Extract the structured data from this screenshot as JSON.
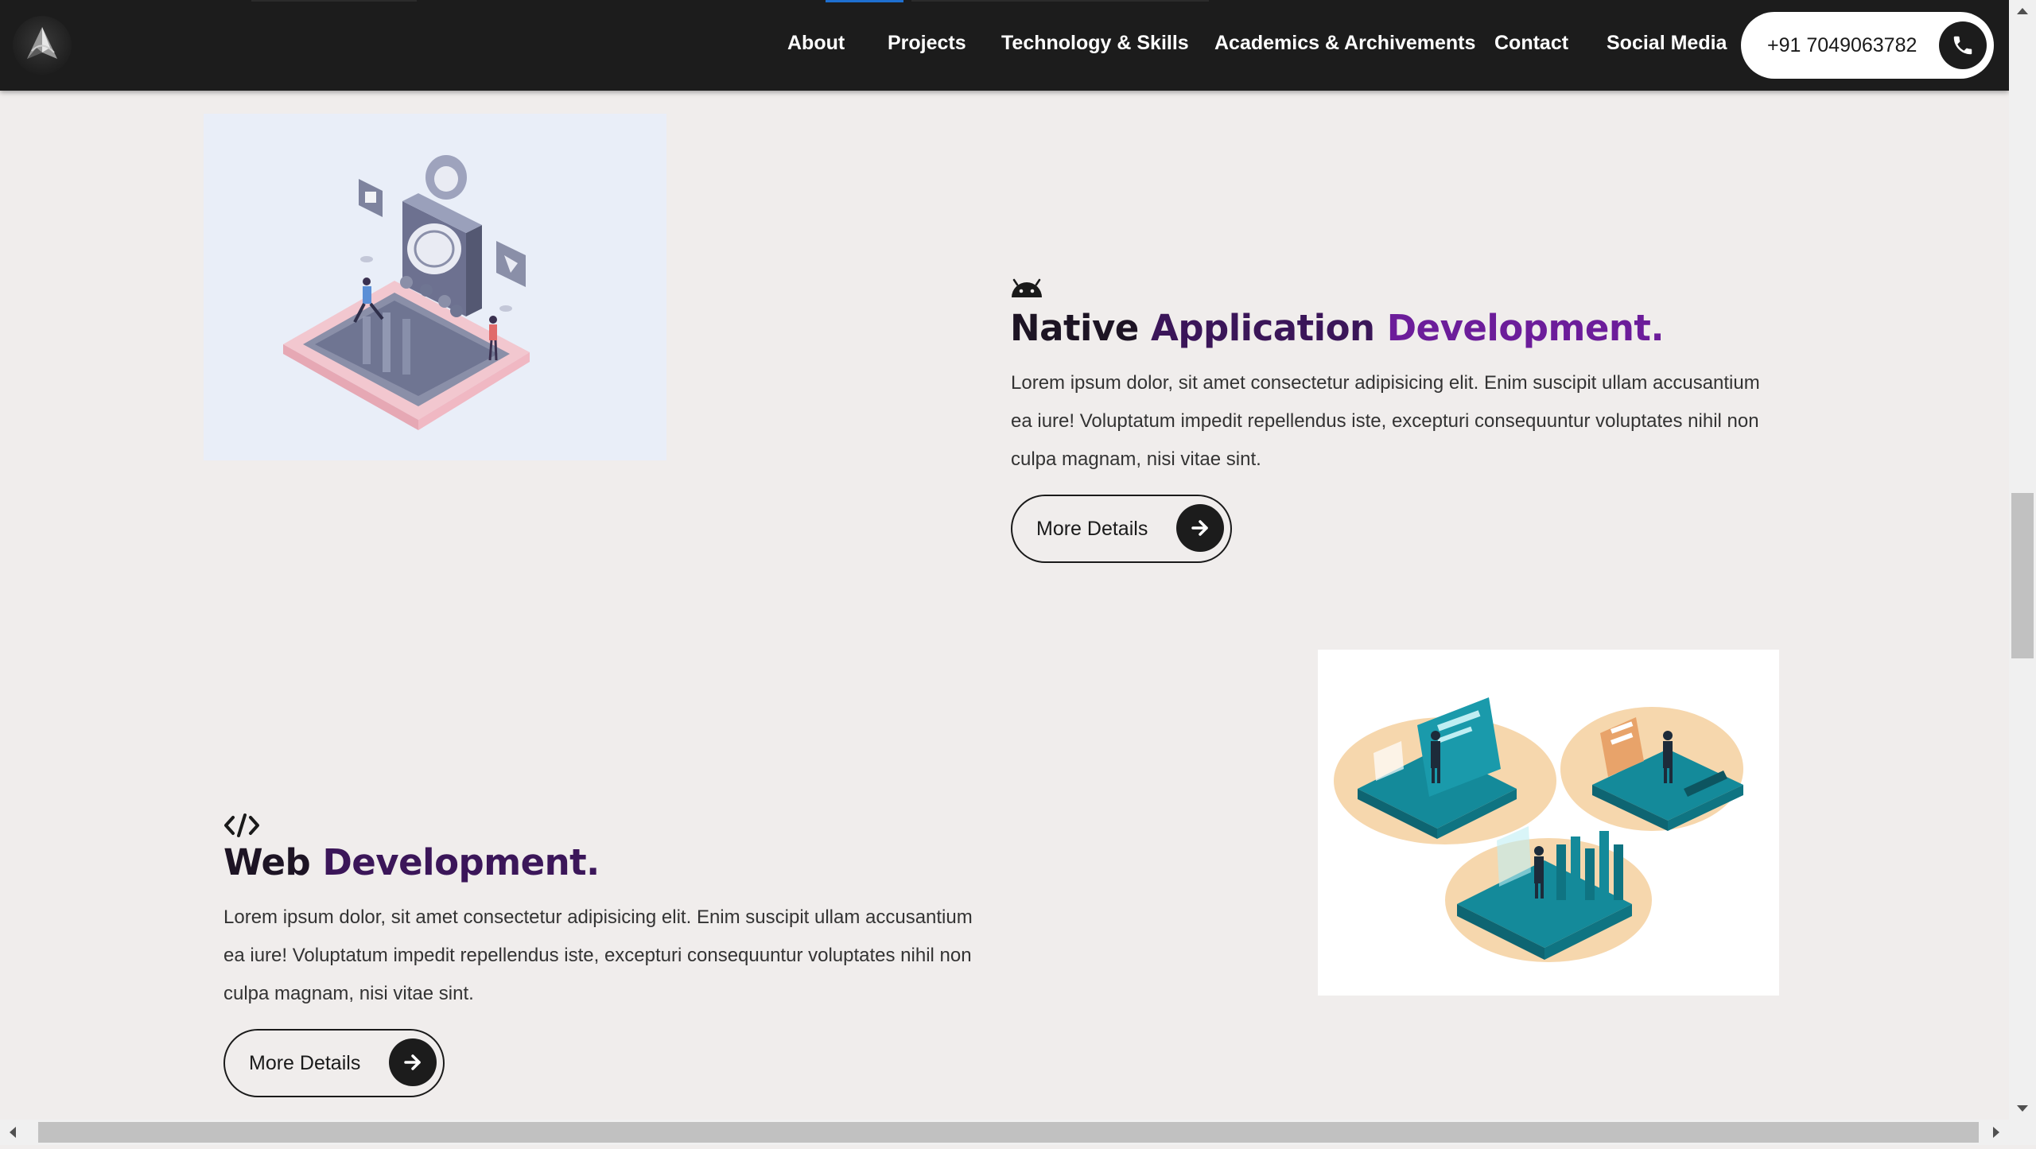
{
  "navbar": {
    "logo_icon": "brand-logo-icon",
    "links": [
      "About",
      "Projects",
      "Technology & Skills",
      "Academics & Archivements",
      "Contact",
      "Social Media"
    ],
    "phone_number": "+91 7049063782",
    "phone_icon": "phone-icon"
  },
  "services": [
    {
      "icon": "android-icon",
      "title_words": [
        "Native",
        "Application",
        "Development."
      ],
      "description": "Lorem ipsum dolor, sit amet consectetur adipisicing elit. Enim suscipit ullam accusantium ea iure! Voluptatum impedit repellendus iste, excepturi consequuntur voluptates nihil non culpa magnam, nisi vitae sint.",
      "button_label": "More Details",
      "button_icon": "arrow-right-icon",
      "illustration": "mobile-app-illustration"
    },
    {
      "icon": "code-icon",
      "title_words": [
        "Web",
        "Development."
      ],
      "description": "Lorem ipsum dolor, sit amet consectetur adipisicing elit. Enim suscipit ullam accusantium ea iure! Voluptatum impedit repellendus iste, excepturi consequuntur voluptates nihil non culpa magnam, nisi vitae sint.",
      "button_label": "More Details",
      "button_icon": "arrow-right-icon",
      "illustration": "web-development-illustration"
    }
  ],
  "colors": {
    "navbar_bg": "#1c1c1c",
    "page_bg": "#f0edec",
    "title_dark": "#1d1424",
    "title_mid": "#3b1659",
    "title_purple": "#6c1d9a",
    "active_indicator": "#1e6fd0"
  }
}
